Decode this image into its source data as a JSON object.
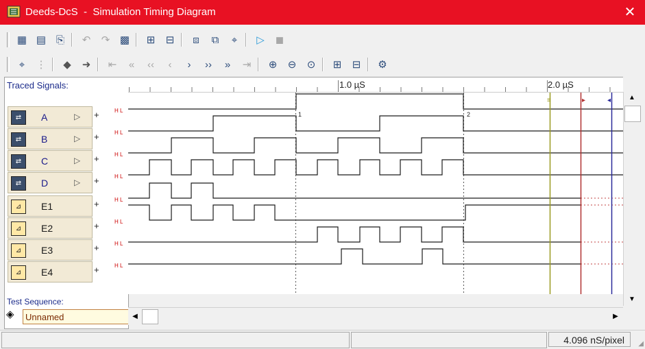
{
  "window": {
    "app_name": "Deeds-DcS",
    "separator": "-",
    "title": "Simulation Timing Diagram",
    "title_full": "Deeds-DcS  -  Simulation Timing Diagram"
  },
  "panel": {
    "traced_label": "Traced Signals:",
    "test_sequence_label": "Test Sequence:",
    "test_sequence_value": "Unnamed"
  },
  "ruler": {
    "marks": [
      "1.0 µS",
      "2.0 µS"
    ]
  },
  "markers": [
    "1",
    "2"
  ],
  "signals": [
    {
      "name": "A",
      "kind": "input",
      "level_labels": "H L"
    },
    {
      "name": "B",
      "kind": "input",
      "level_labels": "H L"
    },
    {
      "name": "C",
      "kind": "input",
      "level_labels": "H L"
    },
    {
      "name": "D",
      "kind": "input",
      "level_labels": "H L"
    },
    {
      "name": "E1",
      "kind": "output",
      "level_labels": "H L"
    },
    {
      "name": "E2",
      "kind": "output",
      "level_labels": "H L"
    },
    {
      "name": "E3",
      "kind": "output",
      "level_labels": "H L"
    },
    {
      "name": "E4",
      "kind": "output",
      "level_labels": "H L"
    }
  ],
  "statusbar": {
    "scale": "4.096 nS/pixel"
  },
  "colors": {
    "titlebar": "#e81123",
    "trace": "#1a1a1a",
    "cursor_olive": "#9a9a20",
    "cursor_red": "#b03030",
    "cursor_blue": "#2a2a9a"
  },
  "icons": {
    "toolbar1": [
      "print-icon",
      "page-setup-icon",
      "export-icon",
      "undo-icon",
      "redo-icon",
      "clipboard-icon",
      "trace-add-icon",
      "trace-remove-icon",
      "signal-group-icon",
      "signal-ungroup-icon",
      "probe-icon",
      "run-icon",
      "stop-icon"
    ],
    "toolbar2": [
      "cursor-icon",
      "cursor-disabled-icon",
      "left-icon",
      "right-icon",
      "first-icon",
      "prev-fast-icon",
      "prev-icon",
      "prev-step-icon",
      "next-step-icon",
      "next-icon",
      "next-fast-icon",
      "last-icon",
      "zoom-in-icon",
      "zoom-out-icon",
      "zoom-fit-icon",
      "insert-icon",
      "delete-icon",
      "settings-icon"
    ]
  }
}
